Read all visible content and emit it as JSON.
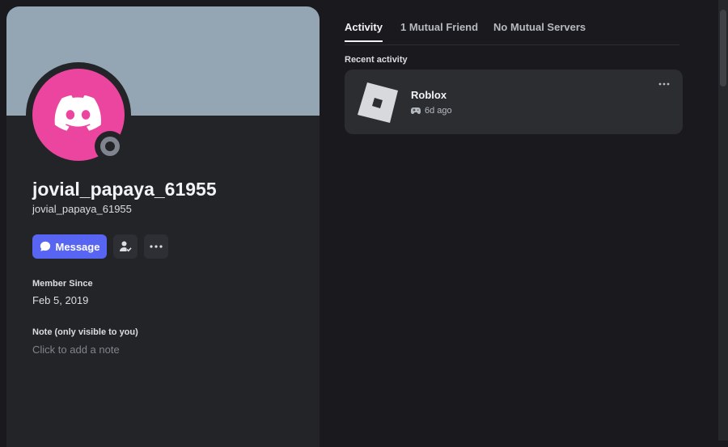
{
  "profile": {
    "display_name": "jovial_papaya_61955",
    "username": "jovial_papaya_61955",
    "avatar_color": "#eb459f",
    "banner_color": "#94a6b3",
    "status": "offline",
    "actions": {
      "message_label": "Message",
      "friend_icon": "add-friend-icon",
      "more_icon": "more-options-icon"
    },
    "member_since_label": "Member Since",
    "member_since_value": "Feb 5, 2019",
    "note_label": "Note (only visible to you)",
    "note_placeholder": "Click to add a note"
  },
  "tabs": [
    {
      "label": "Activity",
      "active": true
    },
    {
      "label": "1 Mutual Friend",
      "active": false
    },
    {
      "label": "No Mutual Servers",
      "active": false
    }
  ],
  "activity": {
    "section_label": "Recent activity",
    "items": [
      {
        "game": "Roblox",
        "time": "6d ago",
        "icon": "roblox-icon"
      }
    ]
  },
  "colors": {
    "accent": "#5865f2",
    "background": "#1a1a1e",
    "panel": "#232428"
  }
}
